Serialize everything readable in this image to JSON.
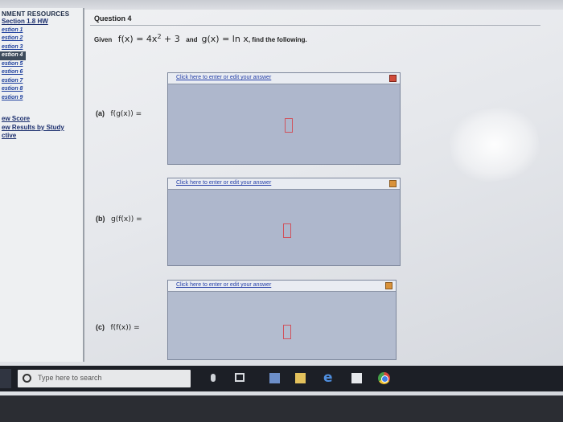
{
  "sidebar": {
    "title": "NMENT RESOURCES",
    "section": "Section 1.8 HW",
    "items": [
      {
        "label": "estion 1"
      },
      {
        "label": "estion 2"
      },
      {
        "label": "estion 3"
      },
      {
        "label": "estion 4",
        "active": true
      },
      {
        "label": "estion 5"
      },
      {
        "label": "estion 6"
      },
      {
        "label": "estion 7"
      },
      {
        "label": "estion 8"
      },
      {
        "label": "estion 9"
      }
    ],
    "links": [
      {
        "label": "ew Score"
      },
      {
        "label": "ew Results by Study"
      },
      {
        "label": "ctive"
      }
    ]
  },
  "question": {
    "title": "Question 4",
    "given_word": "Given",
    "f_def": "f(x) = 4x",
    "f_exp": "2",
    "f_tail": " + 3",
    "and_word": "and",
    "g_def": "g(x) = ln x",
    "tail": ", find the following."
  },
  "parts": [
    {
      "label": "(a)",
      "expr": "f(g(x)) =",
      "link": "Click here to enter or edit your answer"
    },
    {
      "label": "(b)",
      "expr": "g(f(x)) =",
      "link": "Click here to enter or edit your answer"
    },
    {
      "label": "(c)",
      "expr": "f(f(x)) =",
      "link": "Click here to enter or edit your answer"
    }
  ],
  "taskbar": {
    "search_placeholder": "Type here to search"
  },
  "colors": {
    "answer_bg": "#aeb7cc",
    "link": "#2640a8",
    "taskbar": "#1c1f26"
  }
}
